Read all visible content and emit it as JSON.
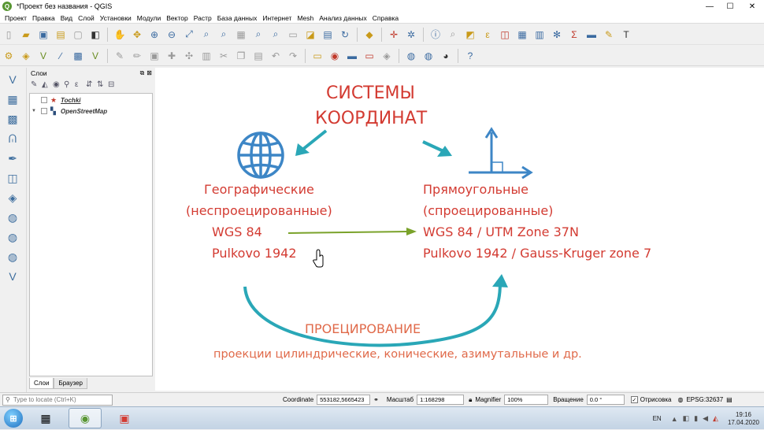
{
  "window": {
    "title": "*Проект без названия - QGIS",
    "logo_letter": "Q",
    "minimize": "—",
    "maximize": "☐",
    "close": "✕"
  },
  "menu": [
    "Проект",
    "Правка",
    "Вид",
    "Слой",
    "Установки",
    "Модули",
    "Вектор",
    "Растр",
    "База данных",
    "Интернет",
    "Mesh",
    "Анализ данных",
    "Справка"
  ],
  "layers_panel": {
    "title": "Слои",
    "layers": [
      {
        "name": "Tochki",
        "icon": "star-point-icon",
        "color": "#c0392b"
      },
      {
        "name": "OpenStreetMap",
        "icon": "raster-tile-icon",
        "color": "#2d4f7c"
      }
    ],
    "tabs": [
      "Слои",
      "Браузер"
    ]
  },
  "canvas": {
    "title_line1": "СИСТЕМЫ",
    "title_line2": "КООРДИНАТ",
    "left_col": [
      "Географические",
      "(неспроецированные)",
      "WGS 84",
      "Pulkovo 1942"
    ],
    "right_col": [
      "Прямоугольные",
      "(спроецированные)",
      "WGS 84 / UTM Zone 37N",
      "Pulkovo 1942 / Gauss-Kruger zone 7"
    ],
    "projection_label": "ПРОЕЦИРОВАНИЕ",
    "projection_types": "проекции цилиндрические, конические, азимутальные и др.",
    "colors": {
      "text": "#d33b32",
      "accent": "#e06a4a",
      "arrow_teal": "#2aa7b7",
      "arrow_green": "#7aa22a",
      "icon_blue": "#3d86c6"
    }
  },
  "statusbar": {
    "locate_placeholder": "Type to locate (Ctrl+K)",
    "coordinate_label": "Coordinate",
    "coordinate_value": "553182,5665423",
    "scale_label": "Масштаб",
    "scale_value": "1:168298",
    "magnifier_label": "Magnifier",
    "magnifier_value": "100%",
    "rotation_label": "Вращение",
    "rotation_value": "0.0 °",
    "render_label": "Отрисовка",
    "crs_label": "EPSG:32637"
  },
  "taskbar": {
    "lang": "EN",
    "time": "19:16",
    "date": "17.04.2020"
  }
}
